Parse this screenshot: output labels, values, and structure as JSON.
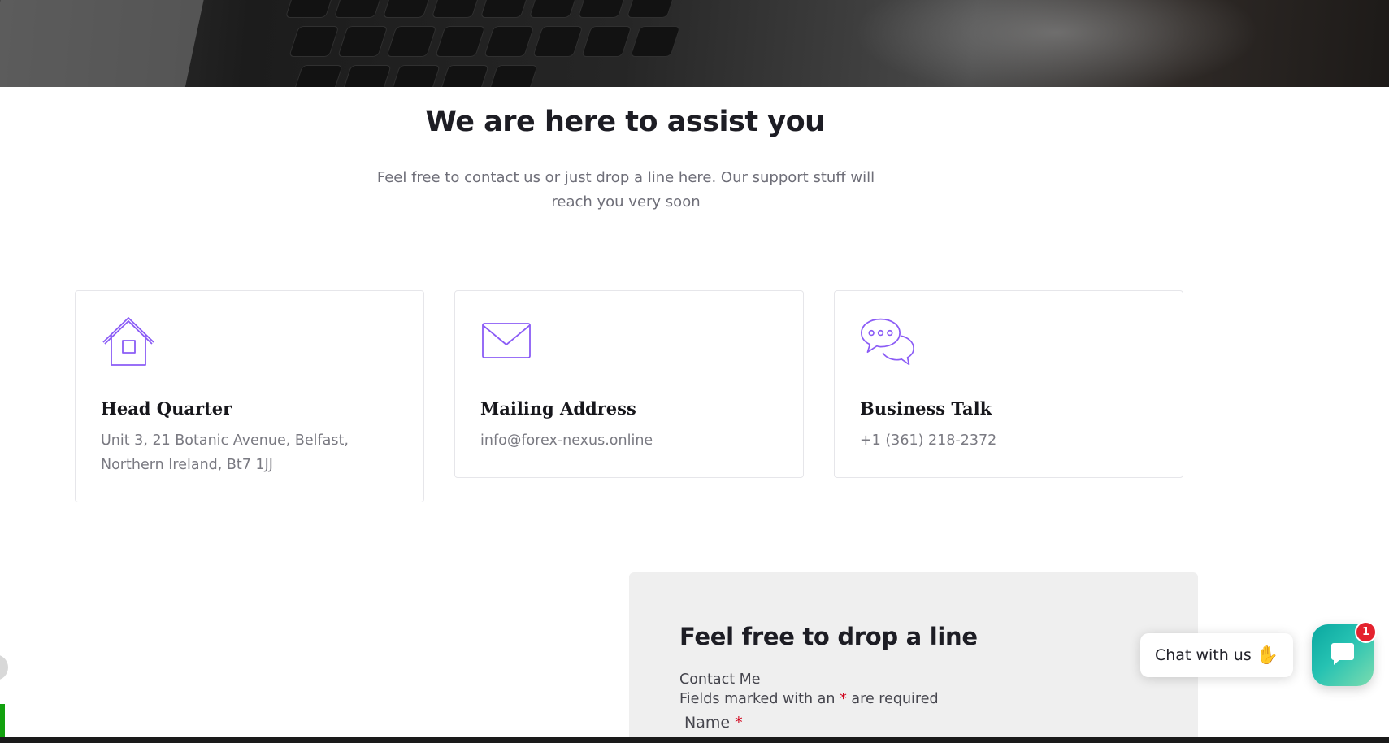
{
  "hero": {
    "image": "laptop-keyboard-photo"
  },
  "intro": {
    "title": "We are here to assist you",
    "subtitle": "Feel free to contact us or just drop a line here. Our support stuff will reach you very soon"
  },
  "cards": [
    {
      "icon": "house-icon",
      "title": "Head Quarter",
      "text": "Unit 3, 21 Botanic Avenue, Belfast, Northern Ireland, Bt7 1JJ"
    },
    {
      "icon": "envelope-icon",
      "title": "Mailing Address",
      "text": "info@forex-nexus.online"
    },
    {
      "icon": "speech-bubbles-icon",
      "title": "Business Talk",
      "text": "+1 (361) 218-2372"
    }
  ],
  "form": {
    "title": "Feel free to drop a line",
    "contact_label": "Contact Me",
    "required_note_prefix": "Fields marked with an",
    "required_mark": "*",
    "required_note_suffix": "are required",
    "name_label": "Name",
    "name_required_mark": "*"
  },
  "chat": {
    "label": "Chat with us",
    "wave_icon": "waving-hand-icon",
    "badge_count": "1"
  },
  "colors": {
    "accent": "#8b5cf6",
    "chat_gradient_start": "#0aa7a0",
    "chat_gradient_end": "#7bdcb0",
    "badge": "#e4222e",
    "required": "#d0021b"
  }
}
